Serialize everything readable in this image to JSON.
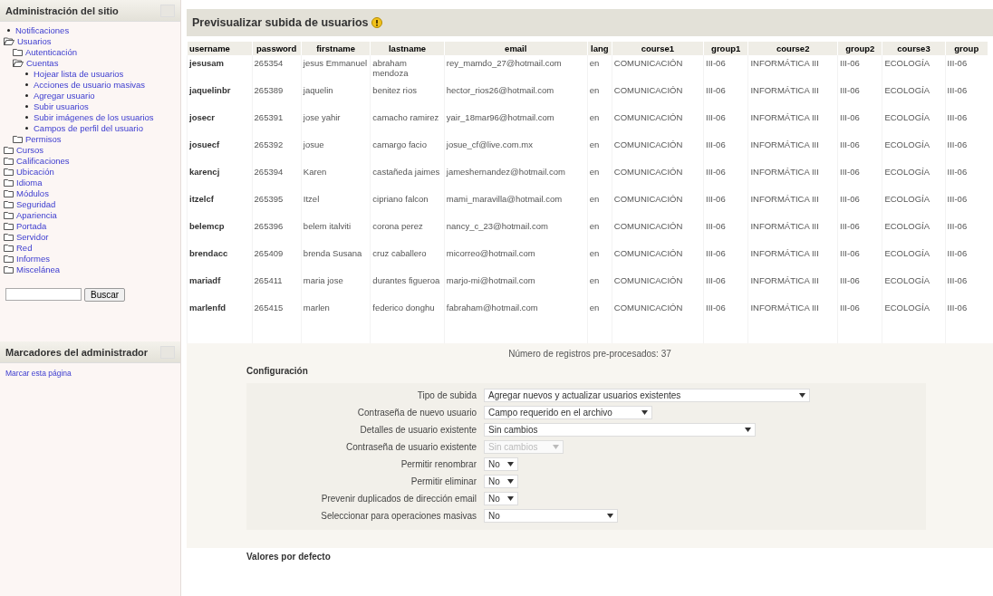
{
  "sidebar": {
    "title": "Administración del sitio",
    "items": [
      {
        "label": "Notificaciones",
        "kind": "leaf"
      },
      {
        "label": "Usuarios",
        "kind": "folder",
        "expanded": true,
        "children": [
          {
            "label": "Autenticación",
            "kind": "folder",
            "expanded": false
          },
          {
            "label": "Cuentas",
            "kind": "folder",
            "expanded": true,
            "children": [
              {
                "label": "Hojear lista de usuarios",
                "kind": "leaf"
              },
              {
                "label": "Acciones de usuario masivas",
                "kind": "leaf"
              },
              {
                "label": "Agregar usuario",
                "kind": "leaf"
              },
              {
                "label": "Subir usuarios",
                "kind": "leaf"
              },
              {
                "label": "Subir imágenes de los usuarios",
                "kind": "leaf"
              },
              {
                "label": "Campos de perfil del usuario",
                "kind": "leaf"
              }
            ]
          },
          {
            "label": "Permisos",
            "kind": "folder",
            "expanded": false
          }
        ]
      },
      {
        "label": "Cursos",
        "kind": "folder",
        "expanded": false
      },
      {
        "label": "Calificaciones",
        "kind": "folder",
        "expanded": false
      },
      {
        "label": "Ubicación",
        "kind": "folder",
        "expanded": false
      },
      {
        "label": "Idioma",
        "kind": "folder",
        "expanded": false
      },
      {
        "label": "Módulos",
        "kind": "folder",
        "expanded": false
      },
      {
        "label": "Seguridad",
        "kind": "folder",
        "expanded": false
      },
      {
        "label": "Apariencia",
        "kind": "folder",
        "expanded": false
      },
      {
        "label": "Portada",
        "kind": "folder",
        "expanded": false
      },
      {
        "label": "Servidor",
        "kind": "folder",
        "expanded": false
      },
      {
        "label": "Red",
        "kind": "folder",
        "expanded": false
      },
      {
        "label": "Informes",
        "kind": "folder",
        "expanded": false
      },
      {
        "label": "Miscelánea",
        "kind": "folder",
        "expanded": false
      }
    ],
    "search_button": "Buscar"
  },
  "bookmarks": {
    "title": "Marcadores del administrador",
    "link": "Marcar esta página"
  },
  "page_title": "Previsualizar subida de usuarios",
  "table": {
    "columns": [
      "username",
      "password",
      "firstname",
      "lastname",
      "email",
      "lang",
      "course1",
      "group1",
      "course2",
      "group2",
      "course3",
      "group"
    ],
    "rows": [
      [
        "jesusam",
        "265354",
        "jesus Emmanuel",
        "abraham mendoza",
        "rey_mamdo_27@hotmail.com",
        "en",
        "COMUNICACIÓN",
        "III-06",
        "INFORMÁTICA III",
        "III-06",
        "ECOLOGÍA",
        "III-06"
      ],
      [
        "jaquelinbr",
        "265389",
        "jaquelin",
        "benitez rios",
        "hector_rios26@hotmail.com",
        "en",
        "COMUNICACIÓN",
        "III-06",
        "INFORMÁTICA III",
        "III-06",
        "ECOLOGÍA",
        "III-06"
      ],
      [
        "josecr",
        "265391",
        "jose yahir",
        "camacho ramirez",
        "yair_18mar96@hotmail.com",
        "en",
        "COMUNICACIÓN",
        "III-06",
        "INFORMÁTICA III",
        "III-06",
        "ECOLOGÍA",
        "III-06"
      ],
      [
        "josuecf",
        "265392",
        "josue",
        "camargo facio",
        "josue_cf@live.com.mx",
        "en",
        "COMUNICACIÓN",
        "III-06",
        "INFORMÁTICA III",
        "III-06",
        "ECOLOGÍA",
        "III-06"
      ],
      [
        "karencj",
        "265394",
        "Karen",
        "castañeda jaimes",
        "jameshernandez@hotmail.com",
        "en",
        "COMUNICACIÓN",
        "III-06",
        "INFORMÁTICA III",
        "III-06",
        "ECOLOGÍA",
        "III-06"
      ],
      [
        "itzelcf",
        "265395",
        "Itzel",
        "cipriano falcon",
        "mami_maravilla@hotmail.com",
        "en",
        "COMUNICACIÓN",
        "III-06",
        "INFORMÁTICA III",
        "III-06",
        "ECOLOGÍA",
        "III-06"
      ],
      [
        "belemcp",
        "265396",
        "belem italviti",
        "corona perez",
        "nancy_c_23@hotmail.com",
        "en",
        "COMUNICACIÓN",
        "III-06",
        "INFORMÁTICA III",
        "III-06",
        "ECOLOGÍA",
        "III-06"
      ],
      [
        "brendacc",
        "265409",
        "brenda Susana",
        "cruz caballero",
        "micorreo@hotmail.com",
        "en",
        "COMUNICACIÓN",
        "III-06",
        "INFORMÁTICA III",
        "III-06",
        "ECOLOGÍA",
        "III-06"
      ],
      [
        "mariadf",
        "265411",
        "maria jose",
        "durantes figueroa",
        "marjo-mi@hotmail.com",
        "en",
        "COMUNICACIÓN",
        "III-06",
        "INFORMÁTICA III",
        "III-06",
        "ECOLOGÍA",
        "III-06"
      ],
      [
        "marlenfd",
        "265415",
        "marlen",
        "federico donghu",
        "fabraham@hotmail.com",
        "en",
        "COMUNICACIÓN",
        "III-06",
        "INFORMÁTICA III",
        "III-06",
        "ECOLOGÍA",
        "III-06"
      ]
    ]
  },
  "record_count": "Número de registros pre-procesados: 37",
  "config": {
    "legend": "Configuración",
    "fields": [
      {
        "label": "Tipo de subida",
        "value": "Agregar nuevos y actualizar usuarios existentes",
        "disabled": false
      },
      {
        "label": "Contraseña de nuevo usuario",
        "value": "Campo requerido en el archivo",
        "disabled": false
      },
      {
        "label": "Detalles de usuario existente",
        "value": "Sin cambios",
        "disabled": false
      },
      {
        "label": "Contraseña de usuario existente",
        "value": "Sin cambios",
        "disabled": true
      },
      {
        "label": "Permitir renombrar",
        "value": "No",
        "disabled": false
      },
      {
        "label": "Permitir eliminar",
        "value": "No",
        "disabled": false
      },
      {
        "label": "Prevenir duplicados de dirección email",
        "value": "No",
        "disabled": false
      },
      {
        "label": "Seleccionar para operaciones masivas",
        "value": "No",
        "disabled": false
      }
    ]
  },
  "defaults_legend": "Valores por defecto"
}
